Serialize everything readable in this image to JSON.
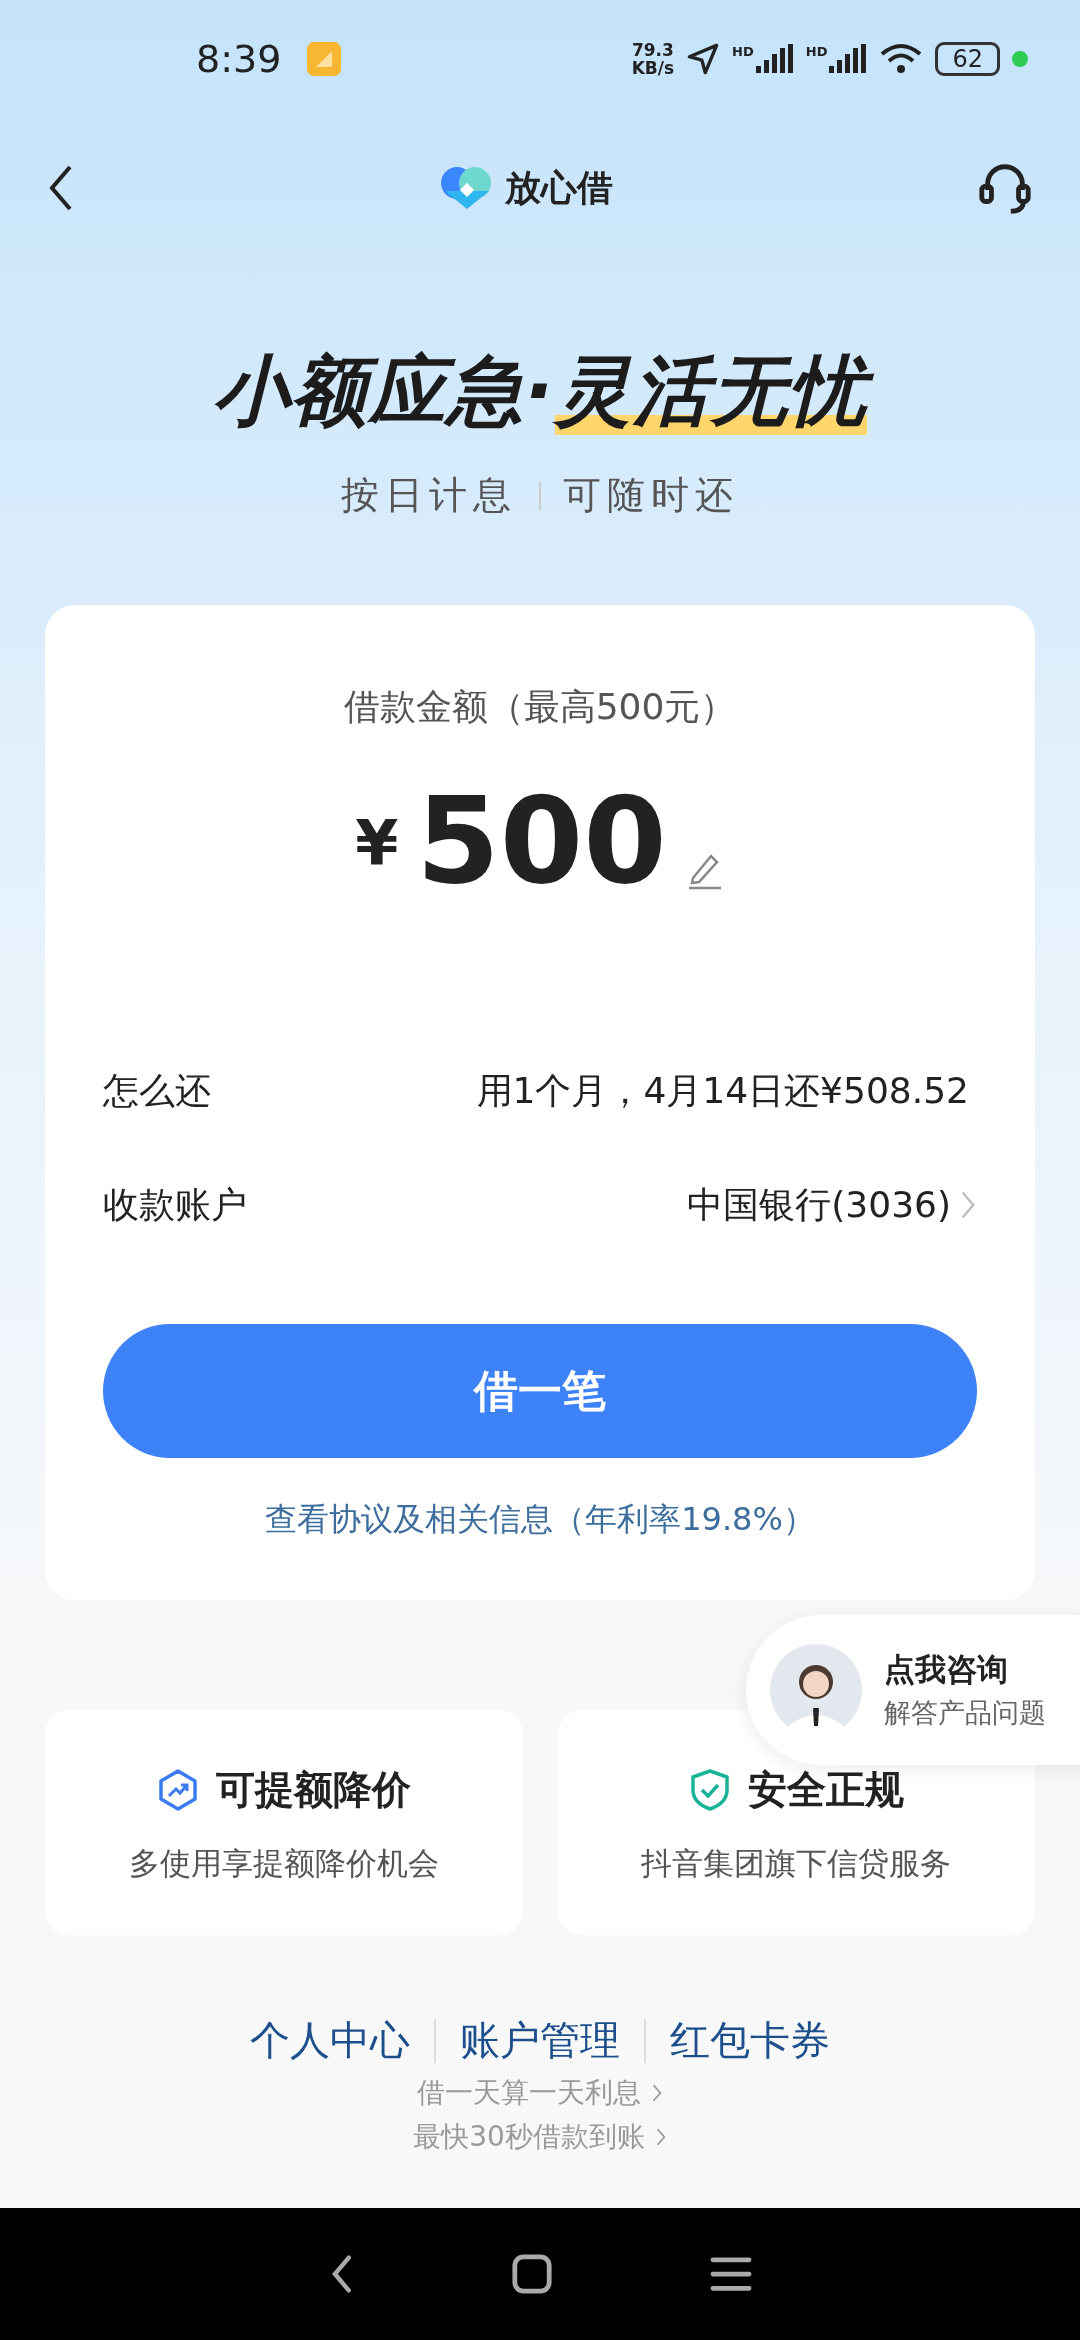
{
  "status_bar": {
    "time": "8:39",
    "speed": "79.3",
    "speed_unit": "KB/s",
    "signal_1": "HD",
    "signal_2": "HD",
    "battery": "62"
  },
  "header": {
    "title": "放心借"
  },
  "hero": {
    "headline_1": "小额应急·",
    "headline_2": "灵活无忧",
    "sub_1": "按日计息",
    "sub_2": "可随时还"
  },
  "loan_card": {
    "amount_label": "借款金额（最高500元）",
    "currency": "¥",
    "amount": "500",
    "rows": [
      {
        "label": "怎么还",
        "value": "用1个月，4月14日还¥508.52",
        "chevron": false
      },
      {
        "label": "收款账户",
        "value": "中国银行(3036)",
        "chevron": true
      }
    ],
    "button": "借一笔",
    "agreement_link": "查看协议及相关信息（年利率19.8%）"
  },
  "consult": {
    "title": "点我咨询",
    "subtitle": "解答产品问题"
  },
  "features": [
    {
      "kind": "growth",
      "title": "可提额降价",
      "desc": "多使用享提额降价机会"
    },
    {
      "kind": "shield",
      "title": "安全正规",
      "desc": "抖音集团旗下信贷服务"
    }
  ],
  "footer_links": [
    "个人中心",
    "账户管理",
    "红包卡券"
  ],
  "ticker": [
    "借一天算一天利息",
    "最快30秒借款到账"
  ]
}
